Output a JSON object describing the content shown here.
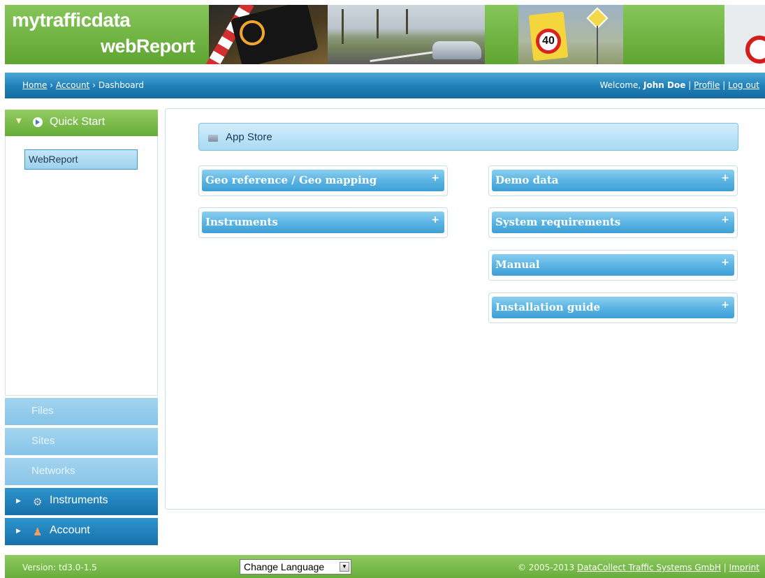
{
  "header": {
    "logo_line1": "mytrafficdata",
    "logo_line2": "webReport"
  },
  "breadcrumb": {
    "items": [
      "Home",
      "Account",
      "Dashboard"
    ],
    "separator": "›"
  },
  "user": {
    "welcome": "Welcome,",
    "name": "John Doe",
    "profile": "Profile",
    "logout": "Log out",
    "divider": "|"
  },
  "sidebar": {
    "quick_start": {
      "label": "Quick Start",
      "icon": "play-circle-icon",
      "item": "WebReport"
    },
    "files": "Files",
    "sites": "Sites",
    "networks": "Networks",
    "instruments": {
      "label": "Instruments",
      "icon": "gear-icon"
    },
    "account": {
      "label": "Account",
      "icon": "user-icon"
    }
  },
  "main": {
    "app_store": "App Store",
    "left_sections": [
      "Geo reference / Geo mapping",
      "Instruments"
    ],
    "right_sections": [
      "Demo data",
      "System requirements",
      "Manual",
      "Installation guide"
    ],
    "expand_symbol": "+"
  },
  "footer": {
    "version": "Version: td3.0-1.5",
    "language_select": "Change Language",
    "copyright_prefix": "© 2005-2013",
    "company": "DataCollect Traffic Systems GmbH",
    "imprint": "Imprint",
    "divider": "|"
  },
  "colors": {
    "brand_green": "#65ac38",
    "nav_blue": "#1670aa",
    "accent_light_blue": "#5cb5e4"
  }
}
